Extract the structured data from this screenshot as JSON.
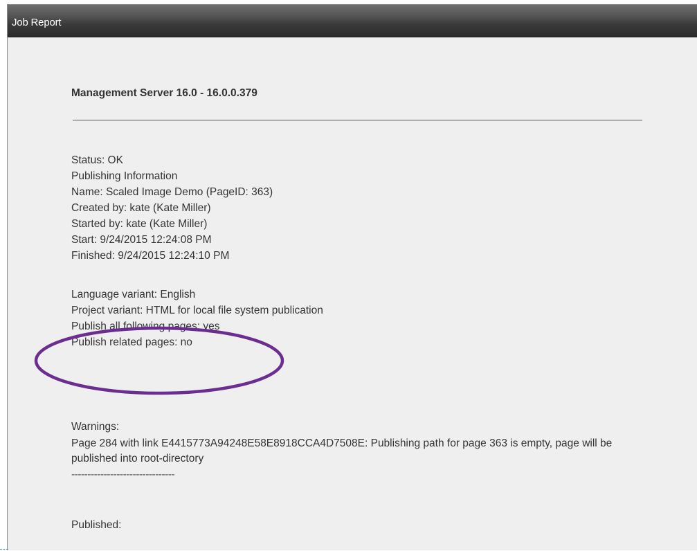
{
  "window": {
    "title": "Job Report"
  },
  "report": {
    "heading": "Management Server 16.0 - 16.0.0.379",
    "status": "Status: OK",
    "publishing_info": "Publishing Information",
    "name": "Name: Scaled Image Demo (PageID: 363)",
    "created_by": "Created by: kate (Kate Miller)",
    "started_by": "Started by: kate (Kate Miller)",
    "start": "Start: 9/24/2015 12:24:08 PM",
    "finished": "Finished: 9/24/2015 12:24:10 PM",
    "language_variant": "Language variant: English",
    "project_variant": "Project variant: HTML for local file system publication",
    "publish_following": "Publish all following pages: yes",
    "publish_related": "Publish related pages: no",
    "warnings_label": "Warnings:",
    "warning_text": "Page 284 with link E4415773A94248E58E8918CCA4D7508E: Publishing path for page 363 is empty, page will be published into root-directory",
    "separator": "--------------------------------",
    "published_label": "Published:"
  },
  "colors": {
    "annotation_ellipse": "#6b2d8f",
    "titlebar": "#3b3b3b",
    "background": "#efefef"
  }
}
